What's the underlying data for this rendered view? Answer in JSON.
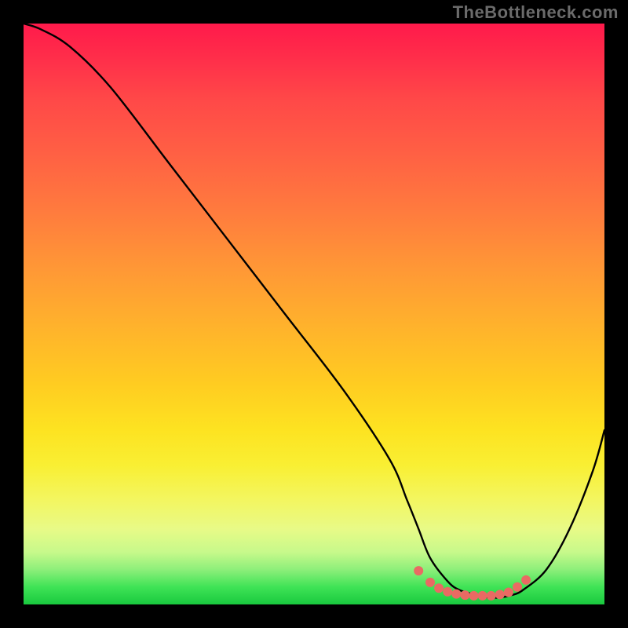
{
  "watermark": "TheBottleneck.com",
  "colors": {
    "background": "#000000",
    "curve": "#000000",
    "marker": "#e96a63",
    "gradient_top": "#ff1a4b",
    "gradient_bottom": "#19c93e"
  },
  "chart_data": {
    "type": "line",
    "title": "",
    "xlabel": "",
    "ylabel": "",
    "xlim": [
      0,
      100
    ],
    "ylim": [
      0,
      100
    ],
    "grid": false,
    "legend": false,
    "note": "No numeric axis ticks are visible in the image; x/y values are read as percentages of the plot area (0–100) measured from the bottom-left.",
    "series": [
      {
        "name": "curve",
        "x": [
          0,
          3,
          8,
          15,
          25,
          35,
          45,
          55,
          63,
          66,
          68,
          70,
          73,
          75,
          78,
          80,
          82,
          84,
          86,
          90,
          94,
          98,
          100
        ],
        "y": [
          100,
          99,
          96,
          89,
          76,
          63,
          50,
          37,
          25,
          18,
          13,
          8,
          4,
          2.5,
          1.6,
          1.2,
          1.2,
          1.6,
          2.5,
          6,
          13,
          23,
          30
        ]
      }
    ],
    "markers": {
      "name": "highlight-dots",
      "x": [
        68,
        70,
        71.5,
        73,
        74.5,
        76,
        77.5,
        79,
        80.5,
        82,
        83.5,
        85,
        86.5
      ],
      "y": [
        5.8,
        3.8,
        2.8,
        2.2,
        1.8,
        1.6,
        1.5,
        1.5,
        1.5,
        1.7,
        2.1,
        3.0,
        4.2
      ]
    }
  }
}
